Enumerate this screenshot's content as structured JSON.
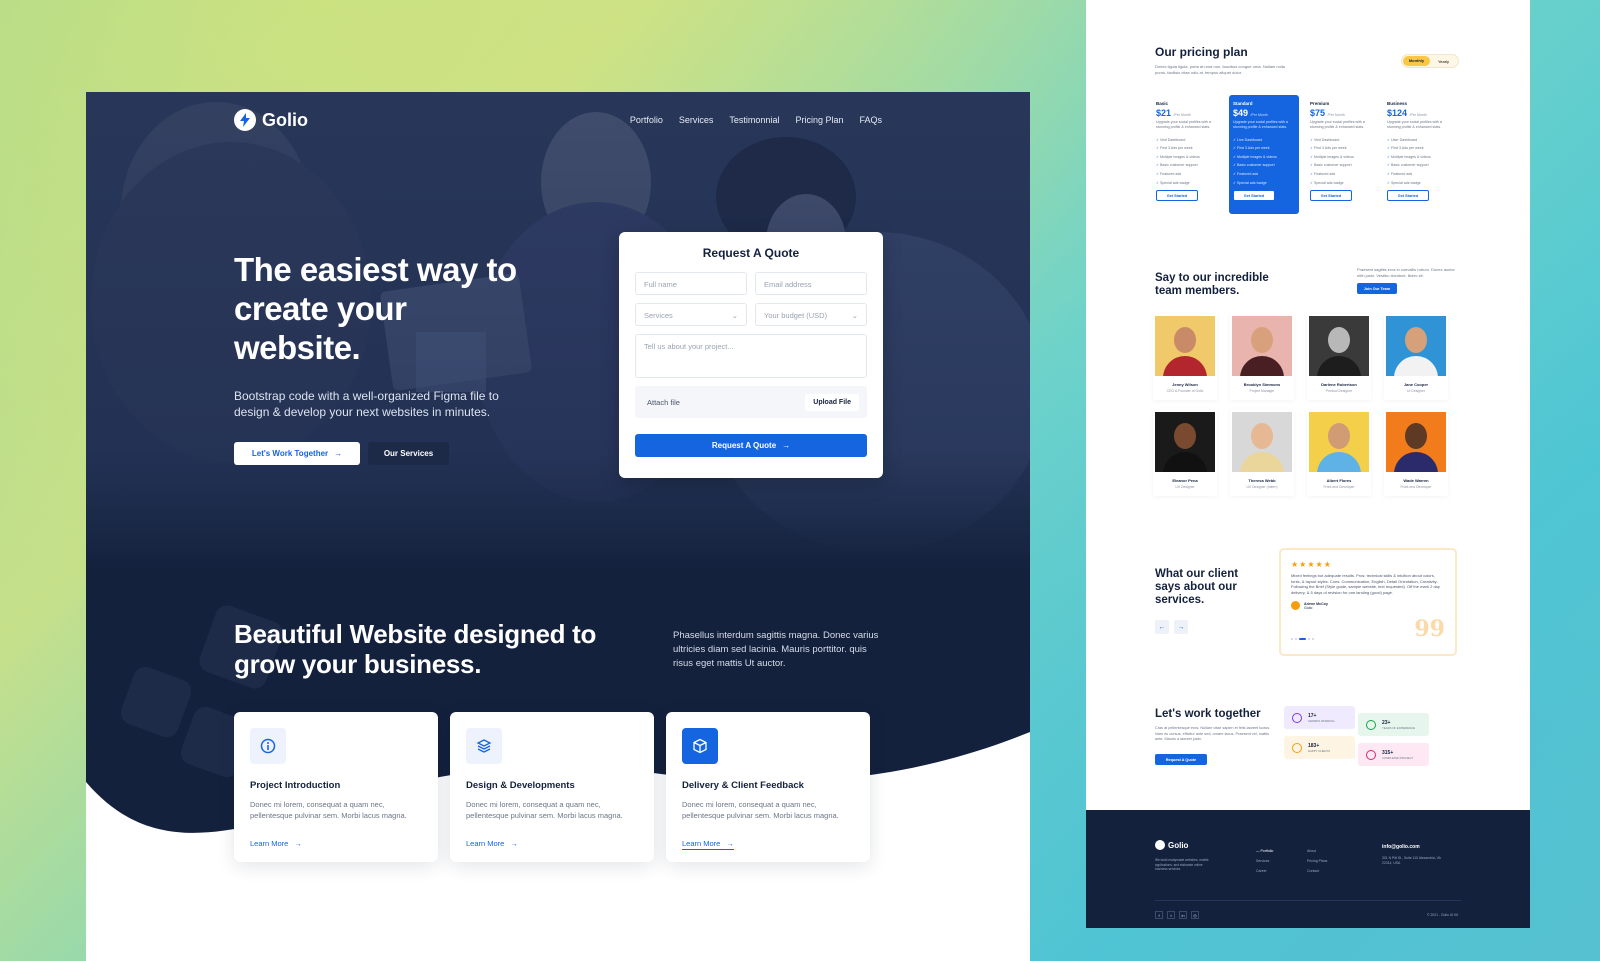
{
  "left_page": {
    "nav": {
      "brand": "Golio",
      "links": [
        "Portfolio",
        "Services",
        "Testimonnial",
        "Pricing Plan",
        "FAQs"
      ]
    },
    "hero": {
      "title": "The easiest way to create your website.",
      "subtitle": "Bootstrap code with a well-organized Figma file to design & develop your next websites in minutes.",
      "primary_button": "Let's Work Together",
      "secondary_button": "Our Services"
    },
    "quote_form": {
      "title": "Request A Quote",
      "full_name_placeholder": "Full name",
      "email_placeholder": "Email address",
      "services_placeholder": "Services",
      "budget_placeholder": "Your budget (USD)",
      "message_placeholder": "Tell us about your project...",
      "attach_label": "Attach file",
      "upload_label": "Upload File",
      "submit_label": "Request A Quote"
    },
    "section": {
      "title": "Beautiful Website designed to grow your business.",
      "description": "Phasellus interdum sagittis magna. Donec varius ultricies diam sed lacinia. Mauris porttitor. quis risus eget mattis Ut auctor."
    },
    "cards": [
      {
        "title": "Project Introduction",
        "text": "Donec mi lorem, consequat a quam nec, pellentesque pulvinar sem. Morbi lacus magna.",
        "link": "Learn More"
      },
      {
        "title": "Design & Developments",
        "text": "Donec mi lorem, consequat a quam nec, pellentesque pulvinar sem. Morbi lacus magna.",
        "link": "Learn More"
      },
      {
        "title": "Delivery & Client Feedback",
        "text": "Donec mi lorem, consequat a quam nec, pellentesque pulvinar sem. Morbi lacus magna.",
        "link": "Learn More"
      }
    ]
  },
  "right_page": {
    "pricing": {
      "title": "Our pricing plan",
      "subtitle": "Donec ligula ligula, porta at urna non, faucibus congue urna. Nullam nulla purus, facilisis vitae odio at, tempus aliquet dolor.",
      "toggle": [
        "Monthly",
        "Yearly"
      ],
      "plans": [
        {
          "name": "Basic",
          "price": "$21",
          "per": "/Per Month",
          "desc": "Upgrade your social profiles with a stunning profile & enhanced stats.",
          "features": [
            "Visit Dashboard",
            "First 3 Ads per week",
            "Multiple images & videos",
            "Basic customer support",
            "Featured ads",
            "Special ads badge"
          ],
          "button": "Get Started"
        },
        {
          "name": "Standard",
          "price": "$49",
          "per": "/Per Month",
          "desc": "Upgrade your social profiles with a stunning profile & enhanced stats.",
          "features": [
            "Live Dashboard",
            "First 3 Ads per week",
            "Multiple images & videos",
            "Basic customer support",
            "Featured ads",
            "Special ads badge"
          ],
          "button": "Get Started"
        },
        {
          "name": "Premium",
          "price": "$75",
          "per": "/Per Month",
          "desc": "Upgrade your social profiles with a stunning profile & enhanced stats.",
          "features": [
            "Visit Dashboard",
            "First 3 Ads per week",
            "Multiple images & videos",
            "Basic customer support",
            "Featured ads",
            "Special ads badge"
          ],
          "button": "Get Started"
        },
        {
          "name": "Business",
          "price": "$124",
          "per": "/Per Month",
          "desc": "Upgrade your social profiles with a stunning profile & enhanced stats.",
          "features": [
            "User Dashboard",
            "First 3 Ads per week",
            "Multiple images & videos",
            "Basic customer support",
            "Featured ads",
            "Special ads badge"
          ],
          "button": "Get Started"
        }
      ]
    },
    "team": {
      "title": "Say to our incredible team members.",
      "description": "Praesent sagittis eros in convallis rutrum. Donec auctor nibh justo. Vestibu tincidunt, libero sit.",
      "button": "Join Our Team",
      "members": [
        {
          "name": "Jenny Wilson",
          "role": "CEO & Founder of Golio",
          "bg": "#f0c96a",
          "skin": "#c98a68",
          "shirt": "#b3262e"
        },
        {
          "name": "Brooklyn Simmons",
          "role": "Project Manager",
          "bg": "#e8b4ad",
          "skin": "#d9a07e",
          "shirt": "#4a1f24"
        },
        {
          "name": "Darlene Robertson",
          "role": "Product Designer",
          "bg": "#3a3a3a",
          "skin": "#b8b8b8",
          "shirt": "#1d1d1d"
        },
        {
          "name": "Jane Cooper",
          "role": "UI Designer",
          "bg": "#2f93d6",
          "skin": "#d6a07a",
          "shirt": "#f2f2f2"
        },
        {
          "name": "Eleanor Pena",
          "role": "UX Designer",
          "bg": "#1a1a1a",
          "skin": "#7a4a30",
          "shirt": "#111111"
        },
        {
          "name": "Theresa Webb",
          "role": "UX Designer (Intern)",
          "bg": "#d8d8d8",
          "skin": "#e6b894",
          "shirt": "#ead59b"
        },
        {
          "name": "Albert Flores",
          "role": "Front-end Developer",
          "bg": "#f4cf4a",
          "skin": "#d19c73",
          "shirt": "#5fb2e6"
        },
        {
          "name": "Wade Warren",
          "role": "Front-end Developer",
          "bg": "#f27b1c",
          "skin": "#5e3a24",
          "shirt": "#2b2b6b"
        }
      ]
    },
    "testimonial": {
      "title": "What our client says about our services.",
      "stars": "★★★★★",
      "text": "Mixed feelings but adequate results. Pros: technical skills & intuition about colors, fonts, & layout styles. Cons: Communication, English, Detail Orientation, Creativity. Following the Brief (Style guide, sample website, text requested). Off the mark 2 day delivery, & 5 days of revision for one landing (good) page.",
      "author": "Arlene McCoy",
      "author_role": "Golio",
      "prev": "←",
      "next": "→",
      "quote_mark": "99"
    },
    "work": {
      "title": "Let's work together",
      "description": "Cras at pellentesque eros. Nullam vitae sapien et felis laoreet luctus. Nam eu cursus, efficitur ante sed, ornare lacus. Praesent vel, mattis ante. Mauris a laoreet justo.",
      "button": "Request A Quote",
      "stats": [
        {
          "value": "17+",
          "label": "AWARDS WORKING",
          "bg": "#efeafd",
          "color": "#7c3aed"
        },
        {
          "value": "23+",
          "label": "YEARS OF EXPERIENCE",
          "bg": "#e7f6ec",
          "color": "#16a34a"
        },
        {
          "value": "183+",
          "label": "HAPPY CLIENTS",
          "bg": "#fdf4e3",
          "color": "#f59e0b"
        },
        {
          "value": "315+",
          "label": "COMPLETED PROJECT",
          "bg": "#fde8f3",
          "color": "#db2777"
        }
      ]
    },
    "footer": {
      "brand": "Golio",
      "description": "We build readymade websites, mobile applications, and elaborate online business services.",
      "col1": [
        "— Portfolio",
        "Services",
        "Career"
      ],
      "col2": [
        "About",
        "Pricing Plans",
        "Contact"
      ],
      "email": "info@golio.com",
      "address": "301 N Pitt St., Suite 110 Alexandria, VA 22314, USA",
      "social": [
        "f",
        "t",
        "in",
        "◎"
      ],
      "copyright": "© 2021 - Golio UI Kit"
    }
  }
}
